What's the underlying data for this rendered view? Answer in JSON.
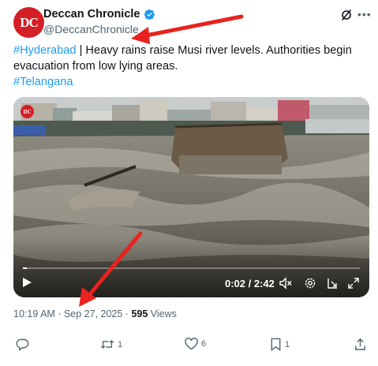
{
  "header": {
    "display_name": "Deccan Chronicle",
    "handle": "@DeccanChronicle",
    "avatar_text": "DC"
  },
  "tweet": {
    "hashtag1": "#Hyderabad",
    "text": " | Heavy rains raise Musi river levels. Authorities begin evacuation from low lying areas.",
    "hashtag2": "#Telangana"
  },
  "video": {
    "watermark": "DC",
    "time_display": "0:02 / 2:42",
    "progress": 0.012
  },
  "meta": {
    "time": "10:19 AM",
    "date": "Sep 27, 2025",
    "views_count": "595",
    "views_label": "Views"
  },
  "actions": {
    "reply_count": "",
    "repost_count": "1",
    "like_count": "6",
    "bookmark_count": "1"
  },
  "colors": {
    "accent": "#1d9bf0",
    "brand_red": "#d51f26",
    "annotation_arrow": "#e8231f",
    "secondary_text": "#536471"
  }
}
